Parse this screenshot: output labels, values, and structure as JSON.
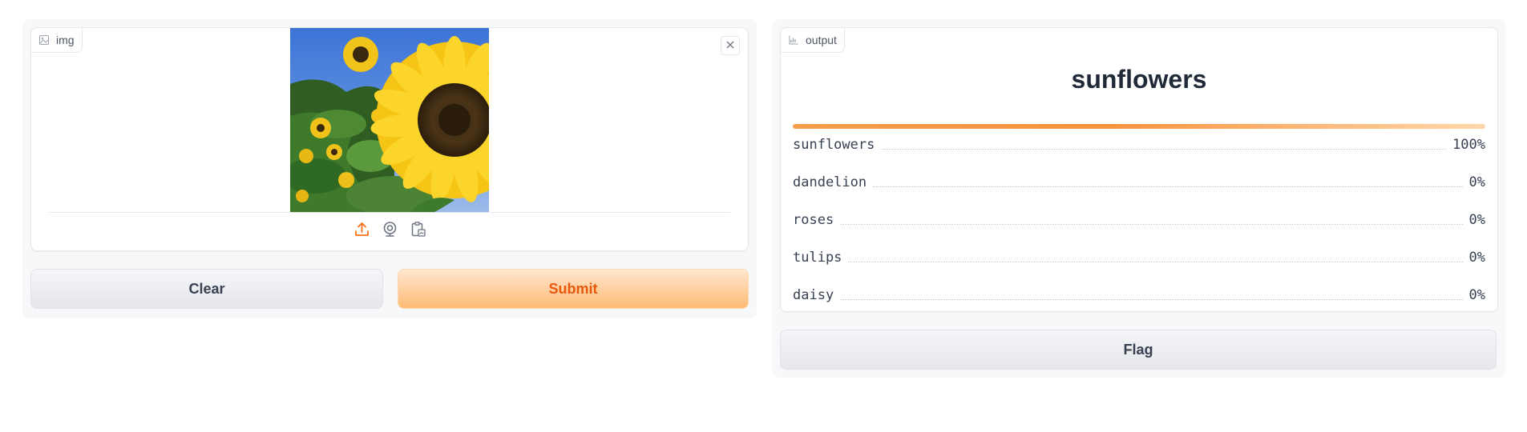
{
  "input": {
    "label": "img",
    "image_alt": "sunflower photo",
    "source_icons": [
      "upload-icon",
      "webcam-icon",
      "clipboard-icon"
    ]
  },
  "output": {
    "label": "output",
    "top_label": "sunflowers",
    "top_confidence": 1.0,
    "confidences": [
      {
        "label": "sunflowers",
        "value": "100%"
      },
      {
        "label": "dandelion",
        "value": "0%"
      },
      {
        "label": "roses",
        "value": "0%"
      },
      {
        "label": "tulips",
        "value": "0%"
      },
      {
        "label": "daisy",
        "value": "0%"
      }
    ]
  },
  "buttons": {
    "clear": "Clear",
    "submit": "Submit",
    "flag": "Flag"
  },
  "colors": {
    "accent": "#ea580c",
    "primary_button": "#fdba74",
    "secondary_button": "#e5e7eb"
  }
}
